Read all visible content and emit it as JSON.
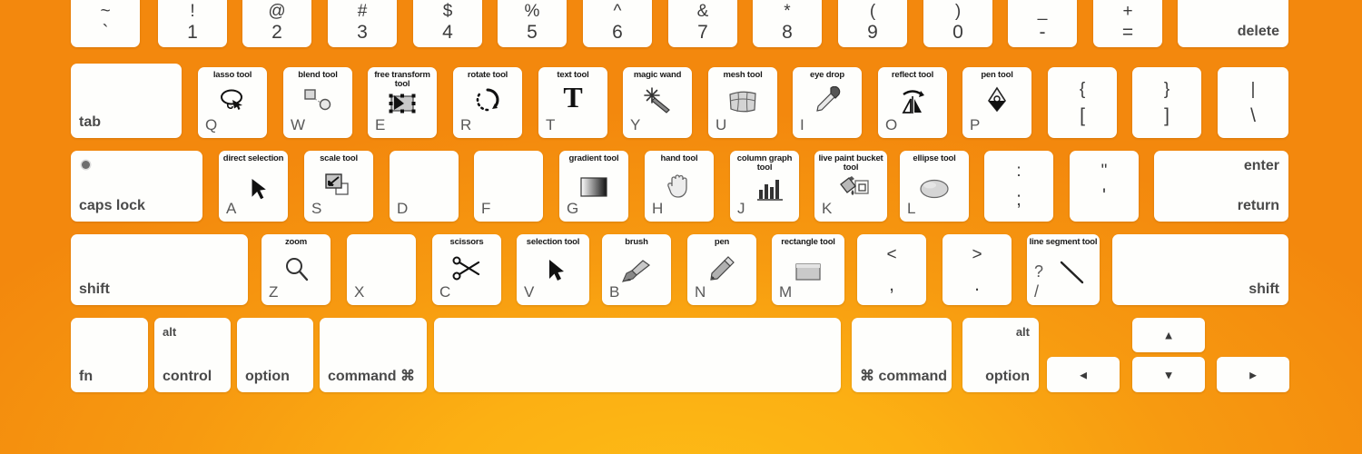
{
  "meta": {
    "title": "Adobe Illustrator Mac keyboard shortcut overlay",
    "background_color": "#F7960F",
    "background_highlight": "#FDBB16",
    "key_color": "#FEFEFC"
  },
  "rows": {
    "number_row": [
      {
        "name": "tilde",
        "top": "~",
        "bottom": "`"
      },
      {
        "name": "one",
        "top": "!",
        "bottom": "1"
      },
      {
        "name": "two",
        "top": "@",
        "bottom": "2"
      },
      {
        "name": "three",
        "top": "#",
        "bottom": "3"
      },
      {
        "name": "four",
        "top": "$",
        "bottom": "4"
      },
      {
        "name": "five",
        "top": "%",
        "bottom": "5"
      },
      {
        "name": "six",
        "top": "^",
        "bottom": "6"
      },
      {
        "name": "seven",
        "top": "&",
        "bottom": "7"
      },
      {
        "name": "eight",
        "top": "*",
        "bottom": "8"
      },
      {
        "name": "nine",
        "top": "(",
        "bottom": "9"
      },
      {
        "name": "zero",
        "top": ")",
        "bottom": "0"
      },
      {
        "name": "minus",
        "top": "_",
        "bottom": "-"
      },
      {
        "name": "equals",
        "top": "+",
        "bottom": "="
      },
      {
        "name": "delete",
        "label": "delete"
      }
    ],
    "qwerty_row": [
      {
        "name": "tab",
        "label": "tab"
      },
      {
        "name": "q",
        "letter": "Q",
        "tool": "lasso tool",
        "icon": "lasso-icon"
      },
      {
        "name": "w",
        "letter": "W",
        "tool": "blend tool",
        "icon": "blend-icon"
      },
      {
        "name": "e",
        "letter": "E",
        "tool": "free transform tool",
        "icon": "free-transform-icon"
      },
      {
        "name": "r",
        "letter": "R",
        "tool": "rotate tool",
        "icon": "rotate-icon"
      },
      {
        "name": "t",
        "letter": "T",
        "tool": "text tool",
        "icon": "text-icon"
      },
      {
        "name": "y",
        "letter": "Y",
        "tool": "magic wand",
        "icon": "magic-wand-icon"
      },
      {
        "name": "u",
        "letter": "U",
        "tool": "mesh tool",
        "icon": "mesh-icon"
      },
      {
        "name": "i",
        "letter": "I",
        "tool": "eye drop",
        "icon": "eyedropper-icon"
      },
      {
        "name": "o",
        "letter": "O",
        "tool": "reflect tool",
        "icon": "reflect-icon"
      },
      {
        "name": "p",
        "letter": "P",
        "tool": "pen tool",
        "icon": "pen-nib-icon"
      },
      {
        "name": "left-bracket",
        "top": "{",
        "bottom": "["
      },
      {
        "name": "right-bracket",
        "top": "}",
        "bottom": "]"
      },
      {
        "name": "backslash",
        "top": "|",
        "bottom": "\\"
      }
    ],
    "home_row": [
      {
        "name": "caps-lock",
        "label": "caps lock"
      },
      {
        "name": "a",
        "letter": "A",
        "tool": "direct selection",
        "icon": "direct-selection-arrow-icon"
      },
      {
        "name": "s",
        "letter": "S",
        "tool": "scale tool",
        "icon": "scale-icon"
      },
      {
        "name": "d",
        "letter": "D"
      },
      {
        "name": "f",
        "letter": "F"
      },
      {
        "name": "g",
        "letter": "G",
        "tool": "gradient tool",
        "icon": "gradient-icon"
      },
      {
        "name": "h",
        "letter": "H",
        "tool": "hand tool",
        "icon": "hand-icon"
      },
      {
        "name": "j",
        "letter": "J",
        "tool": "column graph tool",
        "icon": "column-graph-icon"
      },
      {
        "name": "k",
        "letter": "K",
        "tool": "live paint bucket tool",
        "icon": "paint-bucket-icon"
      },
      {
        "name": "l",
        "letter": "L",
        "tool": "ellipse tool",
        "icon": "ellipse-icon"
      },
      {
        "name": "semicolon",
        "top": ":",
        "bottom": ";"
      },
      {
        "name": "quote",
        "top": "\"",
        "bottom": "'"
      },
      {
        "name": "return",
        "label_top": "enter",
        "label_bottom": "return"
      }
    ],
    "shift_row": [
      {
        "name": "left-shift",
        "label": "shift"
      },
      {
        "name": "z",
        "letter": "Z",
        "tool": "zoom",
        "icon": "zoom-magnifier-icon"
      },
      {
        "name": "x",
        "letter": "X"
      },
      {
        "name": "c",
        "letter": "C",
        "tool": "scissors",
        "icon": "scissors-icon"
      },
      {
        "name": "v",
        "letter": "V",
        "tool": "selection tool",
        "icon": "selection-arrow-icon"
      },
      {
        "name": "b",
        "letter": "B",
        "tool": "brush",
        "icon": "paintbrush-icon"
      },
      {
        "name": "n",
        "letter": "N",
        "tool": "pen",
        "icon": "pencil-icon"
      },
      {
        "name": "m",
        "letter": "M",
        "tool": "rectangle tool",
        "icon": "rectangle-icon"
      },
      {
        "name": "comma",
        "top": "<",
        "bottom": ","
      },
      {
        "name": "period",
        "top": ">",
        "bottom": "."
      },
      {
        "name": "slash",
        "letter": "?",
        "bottom_letter": "/",
        "tool": "line segment tool",
        "icon": "line-segment-icon"
      },
      {
        "name": "right-shift",
        "label": "shift"
      }
    ],
    "bottom_row": [
      {
        "name": "fn",
        "label": "fn"
      },
      {
        "name": "control",
        "label": "control",
        "alt_label": "alt"
      },
      {
        "name": "option-left",
        "label": "option"
      },
      {
        "name": "command-left",
        "label": "command ⌘"
      },
      {
        "name": "space",
        "label": ""
      },
      {
        "name": "command-right",
        "label": "⌘ command"
      },
      {
        "name": "option-right",
        "label": "option",
        "alt_label": "alt"
      }
    ],
    "arrow_keys": [
      {
        "name": "arrow-up",
        "glyph": "▲"
      },
      {
        "name": "arrow-left",
        "glyph": "◄"
      },
      {
        "name": "arrow-down",
        "glyph": "▼"
      },
      {
        "name": "arrow-right",
        "glyph": "►"
      }
    ]
  }
}
